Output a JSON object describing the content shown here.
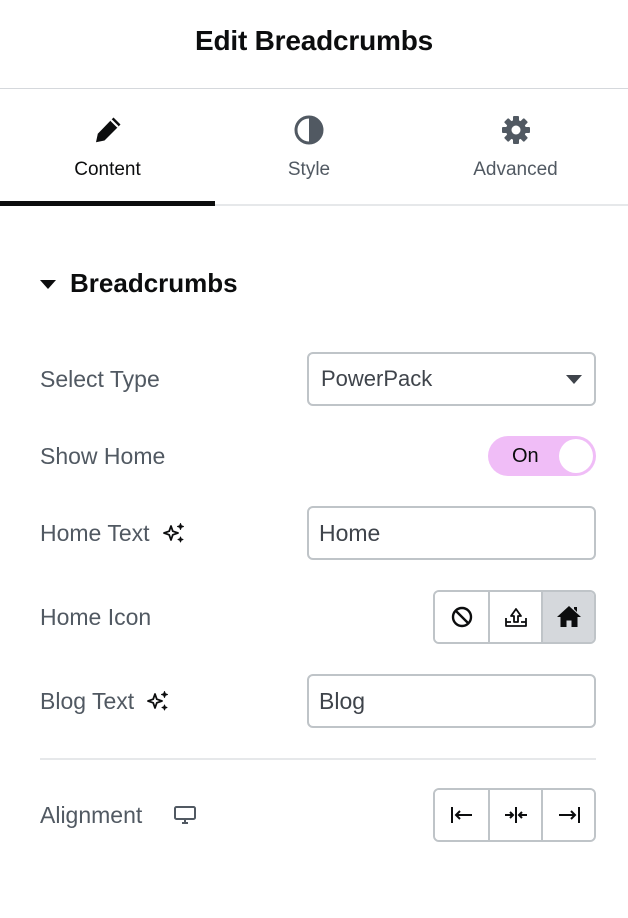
{
  "header": {
    "title": "Edit Breadcrumbs"
  },
  "tabs": [
    {
      "label": "Content",
      "icon": "pencil-icon",
      "active": true
    },
    {
      "label": "Style",
      "icon": "half-circle-icon",
      "active": false
    },
    {
      "label": "Advanced",
      "icon": "gear-icon",
      "active": false
    }
  ],
  "section": {
    "title": "Breadcrumbs",
    "expanded": true
  },
  "fields": {
    "select_type": {
      "label": "Select Type",
      "value": "PowerPack"
    },
    "show_home": {
      "label": "Show Home",
      "state": "On",
      "color": "#f0bdf7"
    },
    "home_text": {
      "label": "Home Text",
      "value": "Home"
    },
    "home_icon": {
      "label": "Home Icon",
      "options": [
        "none-icon",
        "upload-icon",
        "home-icon"
      ],
      "selected": "home-icon"
    },
    "blog_text": {
      "label": "Blog Text",
      "value": "Blog"
    },
    "alignment": {
      "label": "Alignment",
      "options": [
        "align-left-icon",
        "align-center-icon",
        "align-right-icon"
      ]
    }
  }
}
